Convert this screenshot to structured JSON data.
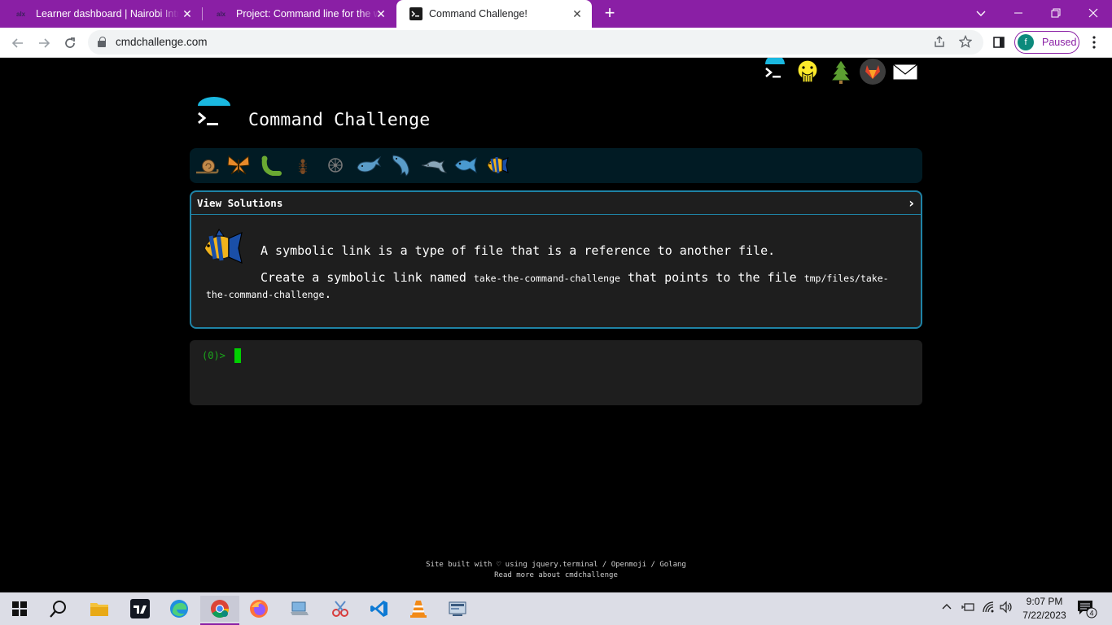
{
  "browser": {
    "tabs": [
      {
        "favicon": "alx",
        "title": "Learner dashboard | Nairobi Intra",
        "active": false
      },
      {
        "favicon": "alx",
        "title": "Project: Command line for the win",
        "active": false
      },
      {
        "favicon": "terminal-icon",
        "title": "Command Challenge!",
        "active": true
      }
    ],
    "close_glyph": "✕",
    "new_tab_glyph": "+",
    "url": "cmdchallenge.com",
    "profile": {
      "initial": "f",
      "status": "Paused"
    },
    "accent_color": "#8a1fa5"
  },
  "page": {
    "title": "Command Challenge",
    "top_icons": [
      "terminal-icon",
      "face-with-hand-over-mouth-icon",
      "evergreen-tree-icon",
      "gitlab-icon",
      "envelope-icon"
    ],
    "levels": [
      "snail",
      "butterfly",
      "bug",
      "ant",
      "wheel",
      "whale",
      "whale2",
      "dolphin",
      "fish",
      "tropical-fish"
    ],
    "challenge": {
      "header": "View Solutions",
      "line1": "A symbolic link is a type of file that is a reference to another file.",
      "line2_pre": "Create a symbolic link named ",
      "link_name": "take-the-command-challenge",
      "line2_mid": " that points to the file ",
      "target": "tmp/files/take-the-command-challenge",
      "line2_end": "."
    },
    "terminal": {
      "prompt": "(0)>"
    },
    "footer": {
      "line1": "Site built with ♡ using jquery.terminal / Openmoji / Golang",
      "line2": "Read more about cmdchallenge"
    }
  },
  "taskbar": {
    "apps": [
      "windows-start",
      "search",
      "file-explorer",
      "tradingview",
      "edge",
      "chrome",
      "firefox",
      "laptop-app",
      "snipping-tool",
      "vscode",
      "vlc",
      "network-app"
    ],
    "time": "9:07 PM",
    "date": "7/22/2023",
    "notifications": "4"
  }
}
